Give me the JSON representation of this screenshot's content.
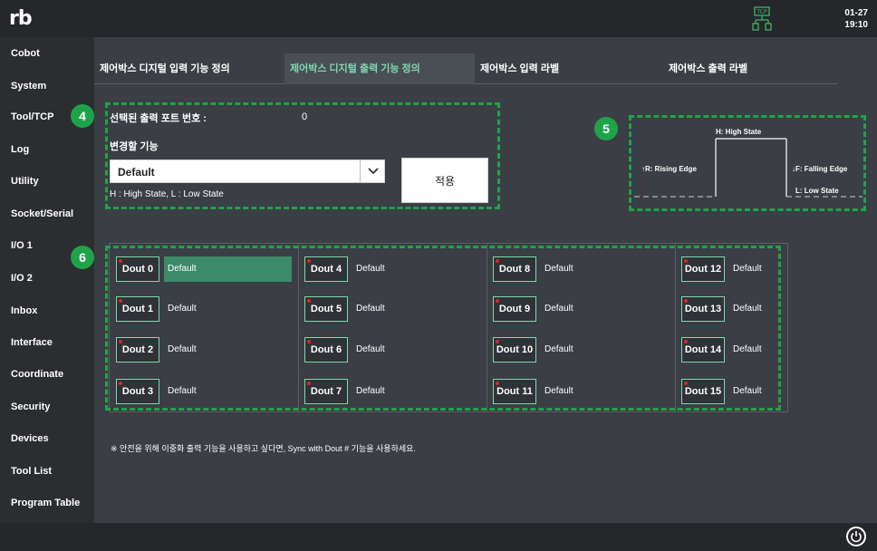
{
  "app": {
    "logo": "rb"
  },
  "status": {
    "tcp_label": "TCP",
    "date": "01-27",
    "time": "19:10"
  },
  "sidebar": {
    "items": [
      {
        "label": "Cobot"
      },
      {
        "label": "System"
      },
      {
        "label": "Tool/TCP"
      },
      {
        "label": "Log"
      },
      {
        "label": "Utility"
      },
      {
        "label": "Socket/Serial"
      },
      {
        "label": "I/O 1"
      },
      {
        "label": "I/O 2"
      },
      {
        "label": "Inbox"
      },
      {
        "label": "Interface"
      },
      {
        "label": "Coordinate"
      },
      {
        "label": "Security"
      },
      {
        "label": "Devices"
      },
      {
        "label": "Tool List"
      },
      {
        "label": "Program Table"
      }
    ],
    "active": "I/O 1"
  },
  "tabs": [
    {
      "label": "제어박스 디지털 입력 기능 정의"
    },
    {
      "label": "제어박스 디지털 출력 기능 정의"
    },
    {
      "label": "제어박스 입력 라벨"
    },
    {
      "label": "제어박스 출력 라벨"
    }
  ],
  "active_tab_index": 1,
  "badges": {
    "b4": "4",
    "b5": "5",
    "b6": "6"
  },
  "config": {
    "selected_port_label": "선택된 출력 포트 번호 :",
    "selected_port_value": "0",
    "function_label": "변경할 기능",
    "function_value": "Default",
    "legend_text": "H : High State, L : Low State",
    "apply_label": "적용"
  },
  "diagram": {
    "high_state": "H: High State",
    "rising_edge": "↑R: Rising Edge",
    "falling_edge": "↓F: Falling Edge",
    "low_state": "L: Low State"
  },
  "outputs": [
    {
      "name": "Dout 0",
      "value": "Default",
      "selected": true
    },
    {
      "name": "Dout 1",
      "value": "Default"
    },
    {
      "name": "Dout 2",
      "value": "Default"
    },
    {
      "name": "Dout 3",
      "value": "Default"
    },
    {
      "name": "Dout 4",
      "value": "Default"
    },
    {
      "name": "Dout 5",
      "value": "Default"
    },
    {
      "name": "Dout 6",
      "value": "Default"
    },
    {
      "name": "Dout 7",
      "value": "Default"
    },
    {
      "name": "Dout 8",
      "value": "Default"
    },
    {
      "name": "Dout 9",
      "value": "Default"
    },
    {
      "name": "Dout 10",
      "value": "Default"
    },
    {
      "name": "Dout 11",
      "value": "Default"
    },
    {
      "name": "Dout 12",
      "value": "Default"
    },
    {
      "name": "Dout 13",
      "value": "Default"
    },
    {
      "name": "Dout 14",
      "value": "Default"
    },
    {
      "name": "Dout 15",
      "value": "Default"
    }
  ],
  "note": "※ 안전을 위해 이중화 출력 기능을 사용하고 싶다면, Sync with Dout # 기능을 사용하세요.",
  "colors": {
    "accent": "#1fa34a",
    "active_tab_text": "#7fd8b0",
    "selected_cell": "#3c8a6a",
    "indicator_red": "#e02424"
  }
}
